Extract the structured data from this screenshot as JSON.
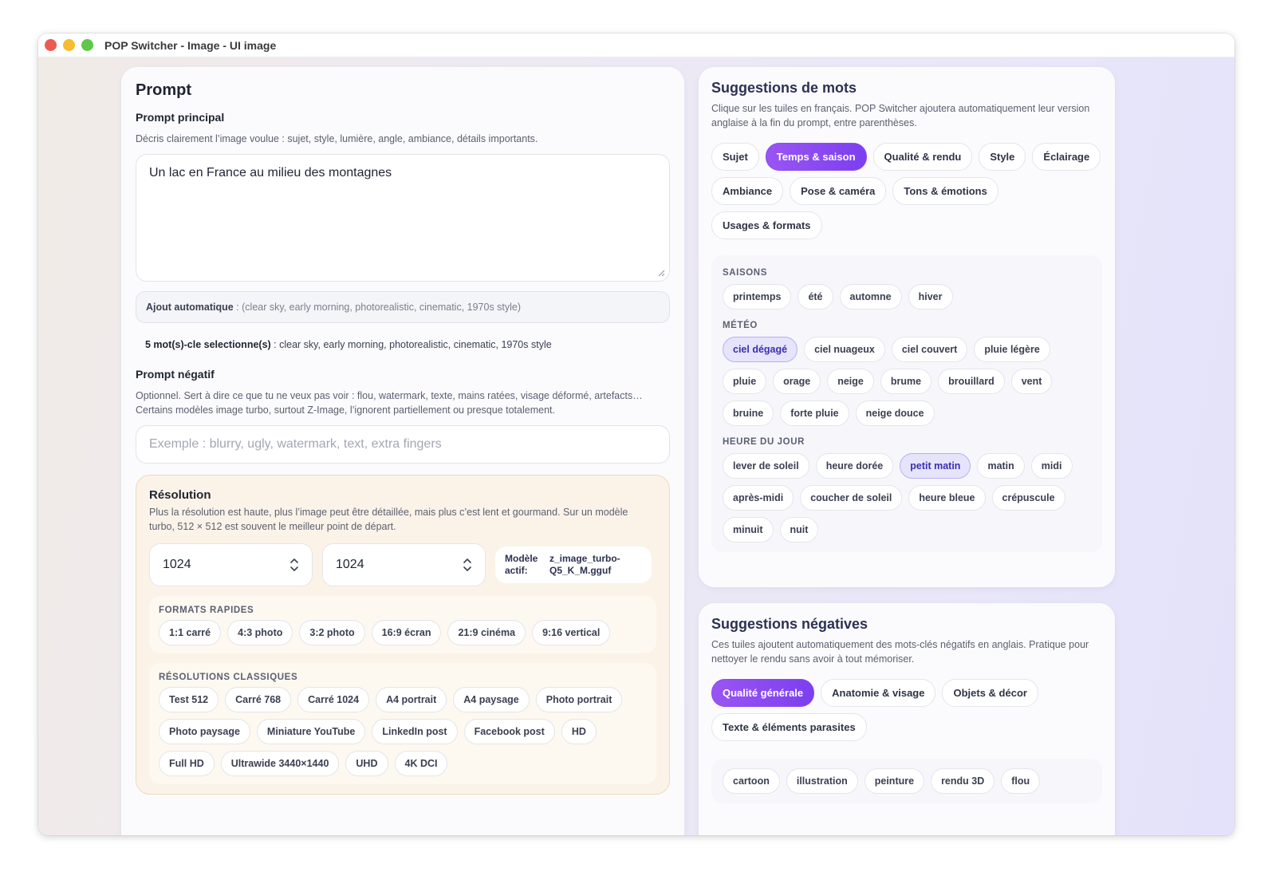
{
  "window": {
    "title": "POP Switcher - Image - UI image"
  },
  "prompt": {
    "title": "Prompt",
    "main_label": "Prompt principal",
    "main_hint": "Décris clairement l’image voulue : sujet, style, lumière, angle, ambiance, détails importants.",
    "main_value": "Un lac en France au milieu des montagnes",
    "auto_label": "Ajout automatique",
    "auto_value": " : (clear sky, early morning, photorealistic, cinematic, 1970s style)",
    "keywords_label": "5 mot(s)-cle selectionne(s)",
    "keywords_value": " : clear sky, early morning, photorealistic, cinematic, 1970s style",
    "negative_label": "Prompt négatif",
    "negative_hint_1": "Optionnel. Sert à dire ce que tu ne veux pas voir : flou, watermark, texte, mains ratées, visage déformé, artefacts…",
    "negative_hint_2": "Certains modèles image turbo, surtout Z-Image, l’ignorent partiellement ou presque totalement.",
    "negative_placeholder": "Exemple : blurry, ugly, watermark, text, extra fingers"
  },
  "resolution": {
    "title": "Résolution",
    "hint_1": "Plus la résolution est haute, plus l’image peut être détaillée, mais plus c’est lent et gourmand. Sur un modèle",
    "hint_2": "turbo, 512 × 512 est souvent le meilleur point de départ.",
    "width": "1024",
    "height": "1024",
    "model_key": "Modèle actif:",
    "model_value": "z_image_turbo-Q5_K_M.gguf",
    "quick_title": "Formats rapides",
    "quick_formats": [
      "1:1 carré",
      "4:3 photo",
      "3:2 photo",
      "16:9 écran",
      "21:9 cinéma",
      "9:16 vertical"
    ],
    "classic_title": "Résolutions classiques",
    "classic": [
      "Test 512",
      "Carré 768",
      "Carré 1024",
      "A4 portrait",
      "A4 paysage",
      "Photo portrait",
      "Photo paysage",
      "Miniature YouTube",
      "LinkedIn post",
      "Facebook post",
      "HD",
      "Full HD",
      "Ultrawide 3440×1440",
      "UHD",
      "4K DCI"
    ]
  },
  "suggestions": {
    "title": "Suggestions de mots",
    "hint": "Clique sur les tuiles en français. POP Switcher ajoutera automatiquement leur version anglaise à la fin du prompt, entre parenthèses.",
    "tabs": [
      "Sujet",
      "Temps & saison",
      "Qualité & rendu",
      "Style",
      "Éclairage",
      "Ambiance",
      "Pose & caméra",
      "Tons & émotions",
      "Usages & formats"
    ],
    "active_tab": 1,
    "groups": [
      {
        "title": "Saisons",
        "items": [
          "printemps",
          "été",
          "automne",
          "hiver"
        ],
        "selected": []
      },
      {
        "title": "Météo",
        "items": [
          "ciel dégagé",
          "ciel nuageux",
          "ciel couvert",
          "pluie légère",
          "pluie",
          "orage",
          "neige",
          "brume",
          "brouillard",
          "vent",
          "bruine",
          "forte pluie",
          "neige douce"
        ],
        "selected": [
          0
        ]
      },
      {
        "title": "Heure du jour",
        "items": [
          "lever de soleil",
          "heure dorée",
          "petit matin",
          "matin",
          "midi",
          "après-midi",
          "coucher de soleil",
          "heure bleue",
          "crépuscule",
          "minuit",
          "nuit"
        ],
        "selected": [
          2
        ]
      }
    ]
  },
  "negative_suggestions": {
    "title": "Suggestions négatives",
    "hint": "Ces tuiles ajoutent automatiquement des mots-clés négatifs en anglais. Pratique pour nettoyer le rendu sans avoir à tout mémoriser.",
    "tabs": [
      "Qualité générale",
      "Anatomie & visage",
      "Objets & décor",
      "Texte & éléments parasites"
    ],
    "active_tab": 0,
    "items": [
      "cartoon",
      "illustration",
      "peinture",
      "rendu 3D",
      "flou"
    ]
  },
  "colors": {
    "accent": "#8b4af1",
    "selected_bg": "#e6e4fb",
    "resolution_bg": "#fbf3e8"
  }
}
